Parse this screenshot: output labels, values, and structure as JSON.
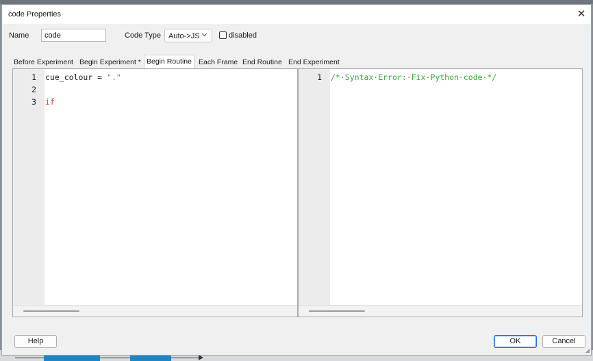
{
  "window": {
    "title": "code Properties",
    "close_glyph": "✕"
  },
  "form": {
    "name_label": "Name",
    "name_value": "code",
    "code_type_label": "Code Type",
    "code_type_value": "Auto->JS",
    "disabled_label": "disabled",
    "disabled_checked": false
  },
  "tabs": [
    {
      "label": "Before Experiment",
      "active": false
    },
    {
      "label": "Begin Experiment *",
      "active": false
    },
    {
      "label": "Begin Routine",
      "active": true
    },
    {
      "label": "Each Frame",
      "active": false
    },
    {
      "label": "End Routine",
      "active": false
    },
    {
      "label": "End Experiment",
      "active": false
    }
  ],
  "python_editor": {
    "lines": [
      {
        "num": "1",
        "text": "cue_colour = \".\""
      },
      {
        "num": "2",
        "text": ""
      },
      {
        "num": "3",
        "text": "if"
      }
    ]
  },
  "js_editor": {
    "lines": [
      {
        "num": "1",
        "text": "/*·Syntax·Error:·Fix·Python·code·*/"
      }
    ]
  },
  "buttons": {
    "help": "Help",
    "ok": "OK",
    "cancel": "Cancel"
  },
  "colors": {
    "code_default": "#1a1a1a",
    "string": "#7a7a7a",
    "keyword_error": "#e03a3a",
    "comment": "#3aa53a",
    "accent": "#2b6fd6"
  },
  "icons": {
    "close": "close-icon",
    "dropdown": "chevron-down-icon",
    "resize": "resize-grip-icon"
  }
}
